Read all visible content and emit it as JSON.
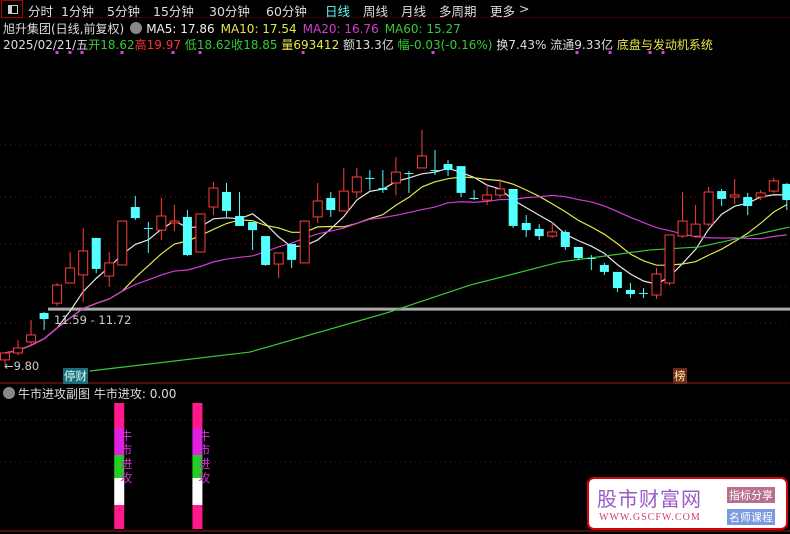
{
  "toolbar": {
    "tabs": [
      "分时",
      "1分钟",
      "5分钟",
      "15分钟",
      "30分钟",
      "60分钟",
      "日线",
      "周线",
      "月线",
      "多周期",
      "更多"
    ],
    "active": "日线",
    "more_arrow": ">"
  },
  "stock": {
    "name": "旭升集团(日线,前复权)",
    "ma5": "MA5: 17.86",
    "ma10": "MA10: 17.54",
    "ma20": "MA20: 16.76",
    "ma60": "MA60: 15.27"
  },
  "quote": {
    "date": "2025/02/21/五",
    "open_l": "开",
    "open": "18.62",
    "high_l": "高",
    "high": "19.97",
    "low_l": "低",
    "low": "18.62",
    "close_l": "收",
    "close": "18.85",
    "vol_l": "量",
    "vol": "693412",
    "amt": "额13.3亿",
    "chg_l": "幅",
    "chg": "-0.03(-0.16%)",
    "turnover": "换7.43%",
    "float": "流通9.33亿",
    "concept": "底盘与发动机系统"
  },
  "annotations": {
    "range": "11.59 - 11.72",
    "low_mark": "9.80",
    "tag1": "停财",
    "tag2": "榜"
  },
  "sub_panel": {
    "title": "牛市进攻副图",
    "value": "牛市进攻: 0.00",
    "bar_text": [
      "牛",
      "市",
      "进",
      "攻"
    ]
  },
  "watermark": {
    "title": "股市财富网",
    "url": "WWW.GSCFW.COM",
    "btn1": "指标分享",
    "btn2": "名师课程"
  },
  "colors": {
    "up": "#ff3c3c",
    "down": "#54ffff",
    "ma5": "#e8e8e8",
    "ma10": "#e6e64a",
    "ma20": "#d43cd4",
    "ma60": "#3cc83c"
  },
  "chart_data": {
    "type": "candlestick",
    "ohlc": [
      [
        10.02,
        10.32,
        9.8,
        10.32
      ],
      [
        10.32,
        10.88,
        10.23,
        10.54
      ],
      [
        10.8,
        11.75,
        10.67,
        11.1
      ],
      [
        12.05,
        12.09,
        11.32,
        11.79
      ],
      [
        12.48,
        13.35,
        12.35,
        13.26
      ],
      [
        13.35,
        14.69,
        13.35,
        14.0
      ],
      [
        13.7,
        15.73,
        12.53,
        14.74
      ],
      [
        15.3,
        15.3,
        13.78,
        13.96
      ],
      [
        13.65,
        14.69,
        13.18,
        14.22
      ],
      [
        14.13,
        16.03,
        14.13,
        16.03
      ],
      [
        16.64,
        17.12,
        16.08,
        16.16
      ],
      [
        15.73,
        15.99,
        14.65,
        15.73
      ],
      [
        15.64,
        17.03,
        15.21,
        16.25
      ],
      [
        15.95,
        16.73,
        15.6,
        16.03
      ],
      [
        16.21,
        16.51,
        14.52,
        14.56
      ],
      [
        14.69,
        16.34,
        14.69,
        16.34
      ],
      [
        16.64,
        17.72,
        16.29,
        17.46
      ],
      [
        17.29,
        17.68,
        16.21,
        16.47
      ],
      [
        16.25,
        17.29,
        15.95,
        15.82
      ],
      [
        15.99,
        15.99,
        14.78,
        15.64
      ],
      [
        15.38,
        15.38,
        14.09,
        14.13
      ],
      [
        14.17,
        14.65,
        13.57,
        14.65
      ],
      [
        15.04,
        15.04,
        14.0,
        14.35
      ],
      [
        14.22,
        16.03,
        14.22,
        16.03
      ],
      [
        16.21,
        17.68,
        15.95,
        16.9
      ],
      [
        17.03,
        17.29,
        16.21,
        16.51
      ],
      [
        16.47,
        18.33,
        16.47,
        17.33
      ],
      [
        17.29,
        18.33,
        17.03,
        17.94
      ],
      [
        17.9,
        18.24,
        17.38,
        17.9
      ],
      [
        17.46,
        18.24,
        17.25,
        17.38
      ],
      [
        17.68,
        18.8,
        17.16,
        18.15
      ],
      [
        18.11,
        18.2,
        17.25,
        18.11
      ],
      [
        18.33,
        19.97,
        18.33,
        18.85
      ],
      [
        18.24,
        19.11,
        18.03,
        18.24
      ],
      [
        18.5,
        18.67,
        17.98,
        18.24
      ],
      [
        18.41,
        18.41,
        17.07,
        17.25
      ],
      [
        17.03,
        17.38,
        16.94,
        17.03
      ],
      [
        16.94,
        17.64,
        16.73,
        17.16
      ],
      [
        17.16,
        17.85,
        17.03,
        17.42
      ],
      [
        17.42,
        17.42,
        15.73,
        15.82
      ],
      [
        15.95,
        16.29,
        15.34,
        15.64
      ],
      [
        15.69,
        15.9,
        15.21,
        15.38
      ],
      [
        15.38,
        15.99,
        15.3,
        15.56
      ],
      [
        15.56,
        15.64,
        14.78,
        14.91
      ],
      [
        14.91,
        14.91,
        14.35,
        14.43
      ],
      [
        14.43,
        14.56,
        13.91,
        14.43
      ],
      [
        14.13,
        14.22,
        13.7,
        13.83
      ],
      [
        13.83,
        13.83,
        12.96,
        13.13
      ],
      [
        13.05,
        13.35,
        12.7,
        12.87
      ],
      [
        12.92,
        13.13,
        12.7,
        12.92
      ],
      [
        12.83,
        14.0,
        12.66,
        13.74
      ],
      [
        13.35,
        15.43,
        13.26,
        15.43
      ],
      [
        15.38,
        17.29,
        15.3,
        16.03
      ],
      [
        15.38,
        16.73,
        15.3,
        15.9
      ],
      [
        15.9,
        17.51,
        15.82,
        17.29
      ],
      [
        17.33,
        17.42,
        16.68,
        16.99
      ],
      [
        17.07,
        17.85,
        16.77,
        17.16
      ],
      [
        17.07,
        17.25,
        16.29,
        16.68
      ],
      [
        17.07,
        17.38,
        16.94,
        17.25
      ],
      [
        17.33,
        17.9,
        17.25,
        17.77
      ],
      [
        17.64,
        17.68,
        16.51,
        16.94
      ]
    ],
    "ma60": [
      [
        6.5,
        9.54
      ],
      [
        18.8,
        10.36
      ],
      [
        29.5,
        12.09
      ],
      [
        35.7,
        13.26
      ],
      [
        42.6,
        14.26
      ],
      [
        49.5,
        14.78
      ],
      [
        53.3,
        14.91
      ],
      [
        60.2,
        15.77
      ]
    ],
    "ref_line": 12.22,
    "ylim": [
      9.8,
      19.97
    ],
    "sub_bars": [
      {
        "index": 8
      },
      {
        "index": 14
      }
    ]
  }
}
